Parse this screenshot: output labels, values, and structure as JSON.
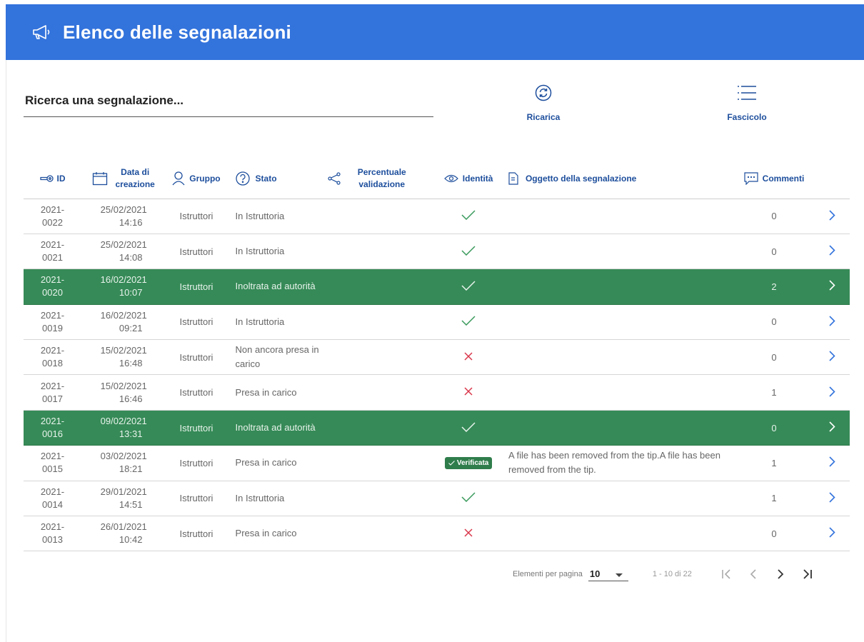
{
  "header": {
    "title": "Elenco delle segnalazioni"
  },
  "search": {
    "placeholder": "Ricerca una segnalazione..."
  },
  "toolbar": {
    "reload_label": "Ricarica",
    "dossier_label": "Fascicolo"
  },
  "columns": {
    "id": "ID",
    "date": "Data di creazione",
    "group": "Gruppo",
    "state": "Stato",
    "percent": "Percentuale validazione",
    "identity": "Identità",
    "subject": "Oggetto della segnalazione",
    "comments": "Commenti"
  },
  "rows": [
    {
      "id": "2021-0022",
      "date": "25/02/2021",
      "time": "14:16",
      "group": "Istruttori",
      "state": "In Istruttoria",
      "identity": "check",
      "badge": "",
      "subject": "",
      "comments": "0",
      "highlighted": false
    },
    {
      "id": "2021-0021",
      "date": "25/02/2021",
      "time": "14:08",
      "group": "Istruttori",
      "state": "In Istruttoria",
      "identity": "check",
      "badge": "",
      "subject": "",
      "comments": "0",
      "highlighted": false
    },
    {
      "id": "2021-0020",
      "date": "16/02/2021",
      "time": "10:07",
      "group": "Istruttori",
      "state": "Inoltrata ad autorità",
      "identity": "check",
      "badge": "",
      "subject": "",
      "comments": "2",
      "highlighted": true
    },
    {
      "id": "2021-0019",
      "date": "16/02/2021",
      "time": "09:21",
      "group": "Istruttori",
      "state": "In Istruttoria",
      "identity": "check",
      "badge": "",
      "subject": "",
      "comments": "0",
      "highlighted": false
    },
    {
      "id": "2021-0018",
      "date": "15/02/2021",
      "time": "16:48",
      "group": "Istruttori",
      "state": "Non ancora presa in carico",
      "identity": "cross",
      "badge": "",
      "subject": "",
      "comments": "0",
      "highlighted": false
    },
    {
      "id": "2021-0017",
      "date": "15/02/2021",
      "time": "16:46",
      "group": "Istruttori",
      "state": "Presa in carico",
      "identity": "cross",
      "badge": "",
      "subject": "",
      "comments": "1",
      "highlighted": false
    },
    {
      "id": "2021-0016",
      "date": "09/02/2021",
      "time": "13:31",
      "group": "Istruttori",
      "state": "Inoltrata ad autorità",
      "identity": "check",
      "badge": "",
      "subject": "",
      "comments": "0",
      "highlighted": true
    },
    {
      "id": "2021-0015",
      "date": "03/02/2021",
      "time": "18:21",
      "group": "Istruttori",
      "state": "Presa in carico",
      "identity": "badge",
      "badge": "Verificata",
      "subject": "A file has been removed from the tip.A file has been removed from the tip.",
      "comments": "1",
      "highlighted": false
    },
    {
      "id": "2021-0014",
      "date": "29/01/2021",
      "time": "14:51",
      "group": "Istruttori",
      "state": "In Istruttoria",
      "identity": "check",
      "badge": "",
      "subject": "",
      "comments": "1",
      "highlighted": false
    },
    {
      "id": "2021-0013",
      "date": "26/01/2021",
      "time": "10:42",
      "group": "Istruttori",
      "state": "Presa in carico",
      "identity": "cross",
      "badge": "",
      "subject": "",
      "comments": "0",
      "highlighted": false
    }
  ],
  "pagination": {
    "per_page_label": "Elementi per pagina",
    "per_page_value": "10",
    "range": "1 - 10 di 22"
  },
  "colors": {
    "header": "#3373dc",
    "highlight_row": "#368a57",
    "check": "#3a9a5c",
    "cross": "#d9364a",
    "accent": "#1d4e9c"
  }
}
